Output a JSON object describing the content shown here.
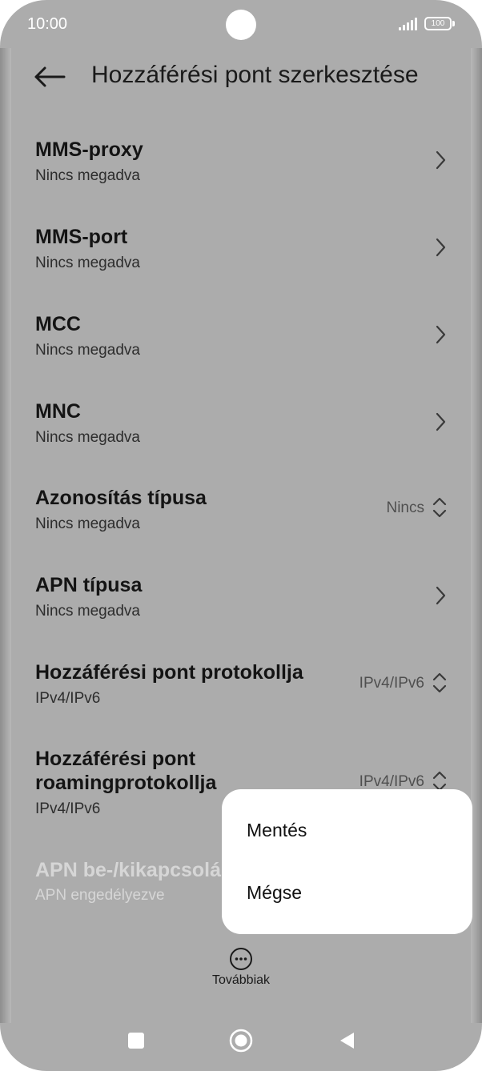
{
  "status_bar": {
    "time": "10:00",
    "battery": "100"
  },
  "header": {
    "title": "Hozzáférési pont szerkesztése"
  },
  "rows": [
    {
      "title": "MMS-proxy",
      "subtitle": "Nincs megadva",
      "value": "",
      "control": "chevron"
    },
    {
      "title": "MMS-port",
      "subtitle": "Nincs megadva",
      "value": "",
      "control": "chevron"
    },
    {
      "title": "MCC",
      "subtitle": "Nincs megadva",
      "value": "",
      "control": "chevron"
    },
    {
      "title": "MNC",
      "subtitle": "Nincs megadva",
      "value": "",
      "control": "chevron"
    },
    {
      "title": "Azonosítás típusa",
      "subtitle": "Nincs megadva",
      "value": "Nincs",
      "control": "updown"
    },
    {
      "title": "APN típusa",
      "subtitle": "Nincs megadva",
      "value": "",
      "control": "chevron"
    },
    {
      "title": "Hozzáférési pont protokollja",
      "subtitle": "IPv4/IPv6",
      "value": "IPv4/IPv6",
      "control": "updown"
    },
    {
      "title_line1": "Hozzáférési pont",
      "title_line2": "roamingprotokollja",
      "subtitle": "IPv4/IPv6",
      "value": "IPv4/IPv6",
      "control": "updown"
    },
    {
      "title": "APN be-/kikapcsolá",
      "subtitle": "APN engedélyezve",
      "enabled": false
    }
  ],
  "more": {
    "label": "Továbbiak",
    "icon": "more-horizontal-icon"
  },
  "popup_menu": {
    "items": [
      "Mentés",
      "Mégse"
    ]
  },
  "nav_bar": {
    "icons": [
      "recents-square-icon",
      "home-circle-icon",
      "back-triangle-icon"
    ]
  },
  "colors": {
    "overlay_background": "#acacac",
    "popup_background": "#ffffff",
    "text": "#141414"
  }
}
